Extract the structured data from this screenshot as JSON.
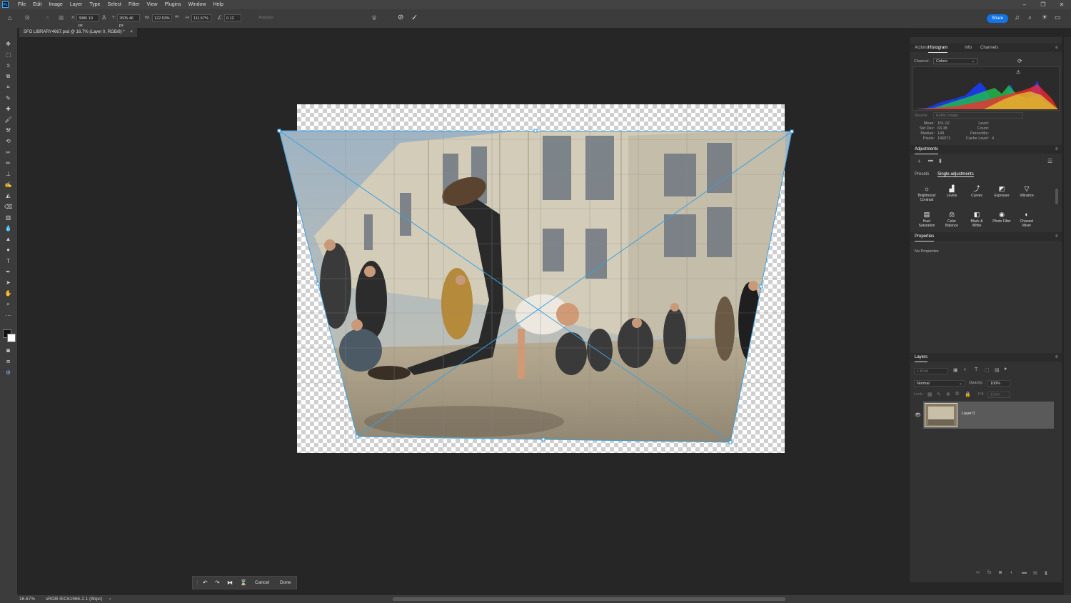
{
  "app": {
    "logo": "Ps"
  },
  "menu": [
    "File",
    "Edit",
    "Image",
    "Layer",
    "Type",
    "Select",
    "Filter",
    "View",
    "Plugins",
    "Window",
    "Help"
  ],
  "window_controls": [
    "–",
    "❐",
    "✕"
  ],
  "options": {
    "x_label": "X:",
    "x_value": "3986.19 px",
    "y_label": "Y:",
    "y_value": "2605.46 px",
    "w_label": "W:",
    "w_value": "122.53%",
    "h_label": "H:",
    "h_value": "111.57%",
    "angle_value": "0.12",
    "antialias": "Antialias",
    "share": "Share"
  },
  "document_tab": {
    "title": "SFO LIBRARY4667.psd @ 16.7% (Layer 0, RGB/8) *",
    "close": "×"
  },
  "floating_bar": {
    "cancel": "Cancel",
    "done": "Done"
  },
  "status": {
    "zoom": "16.67%",
    "profile": "sRGB IEC61966-2.1 (8bpc)",
    "arrow": "›"
  },
  "panels": {
    "histogram_tabs": [
      "Actions",
      "Histogram",
      "Info",
      "Channels"
    ],
    "channel_label": "Channel:",
    "channel_value": "Colors",
    "source_label": "Source:",
    "source_value": "Entire Image",
    "stats_left": [
      {
        "label": "Mean:",
        "value": "151.02"
      },
      {
        "label": "Std Dev:",
        "value": "63.38"
      },
      {
        "label": "Median:",
        "value": "149"
      },
      {
        "label": "Pixels:",
        "value": "146971"
      }
    ],
    "stats_right": [
      {
        "label": "Level:",
        "value": ""
      },
      {
        "label": "Count:",
        "value": ""
      },
      {
        "label": "Percentile:",
        "value": ""
      },
      {
        "label": "Cache Level:",
        "value": "4"
      }
    ],
    "adjustments_title": "Adjustments",
    "adj_tabs": [
      "Presets",
      "Single adjustments"
    ],
    "adj_items": [
      {
        "label1": "Brightness/",
        "label2": "Contrast",
        "icon": "☼"
      },
      {
        "label1": "Levels",
        "label2": "",
        "icon": "▟"
      },
      {
        "label1": "Curves",
        "label2": "",
        "icon": "⤴"
      },
      {
        "label1": "Exposure",
        "label2": "",
        "icon": "◩"
      },
      {
        "label1": "Vibrance",
        "label2": "",
        "icon": "▽"
      },
      {
        "label1": "Hue/",
        "label2": "Saturation",
        "icon": "▤"
      },
      {
        "label1": "Color",
        "label2": "Balance",
        "icon": "⚖"
      },
      {
        "label1": "Black &",
        "label2": "White",
        "icon": "◧"
      },
      {
        "label1": "Photo Filter",
        "label2": "",
        "icon": "◉"
      },
      {
        "label1": "Channel",
        "label2": "Mixer",
        "icon": "◐"
      }
    ],
    "properties_title": "Properties",
    "properties_empty": "No Properties",
    "layers_title": "Layers",
    "layers_search": "Kind",
    "blend_mode": "Normal",
    "opacity_label": "Opacity:",
    "opacity_value": "100%",
    "lock_label": "Lock:",
    "fill_label": "Fill:",
    "fill_value": "100%",
    "layer_name": "Layer 0"
  }
}
